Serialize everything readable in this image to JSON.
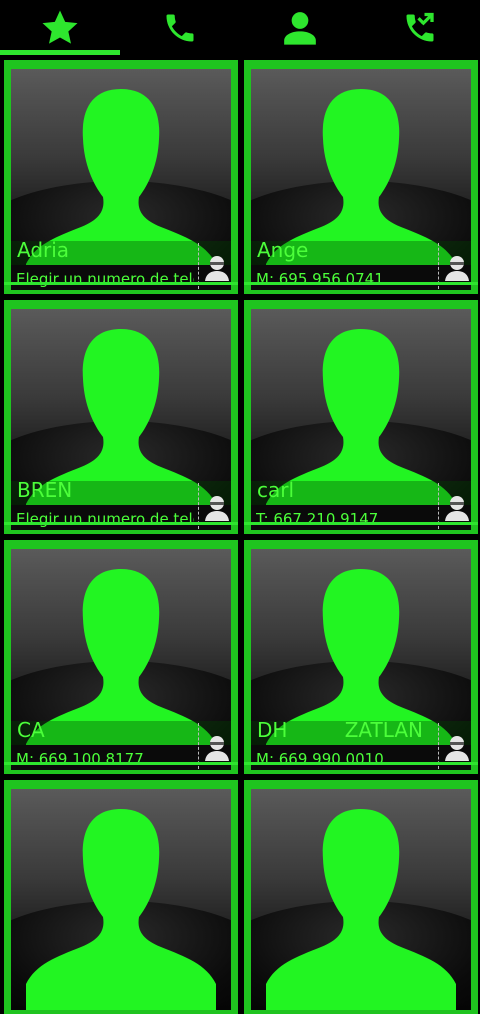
{
  "tabs": [
    {
      "icon": "star-icon",
      "label": "Favorites",
      "selected": true
    },
    {
      "icon": "phone-icon",
      "label": "Phone",
      "selected": false
    },
    {
      "icon": "person-icon",
      "label": "Contacts",
      "selected": false
    },
    {
      "icon": "call-log-icon",
      "label": "Call log",
      "selected": false
    }
  ],
  "colors": {
    "accent": "#2ee62e",
    "text": "#4cff3a",
    "silhouette": "#22f522",
    "background": "#000000"
  },
  "contacts": [
    {
      "name": "Adria",
      "name_extra": "",
      "phone": "Elegir un numero de teléfo..."
    },
    {
      "name": "Ange",
      "name_extra": "",
      "phone": "M: 695 956 0741"
    },
    {
      "name": "BREN",
      "name_extra": "",
      "phone": "Elegir un numero de teléfo..."
    },
    {
      "name": "carl",
      "name_extra": "",
      "phone": "T: 667 210 9147"
    },
    {
      "name": "CA",
      "name_extra": "",
      "phone": "M: 669 100 8177"
    },
    {
      "name": "DH",
      "name_extra": "ZATLAN",
      "phone": "M: 669 990 0010"
    },
    {
      "name": "",
      "name_extra": "",
      "phone": ""
    },
    {
      "name": "",
      "name_extra": "",
      "phone": ""
    }
  ]
}
